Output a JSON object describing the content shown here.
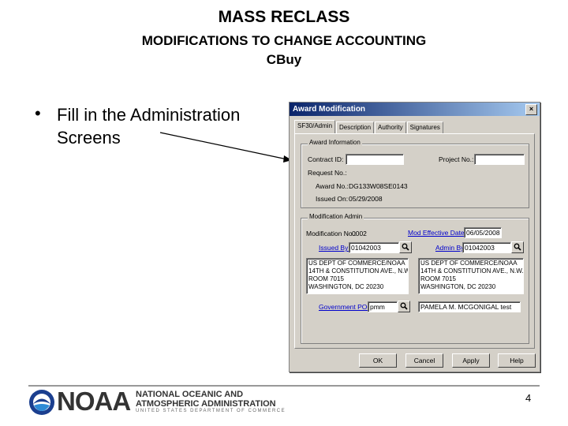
{
  "slide": {
    "title": "MASS RECLASS",
    "subtitle_line1": "MODIFICATIONS TO CHANGE ACCOUNTING",
    "subtitle_line2": "CBuy",
    "bullet_glyph": "•",
    "bullet_text": "Fill in the Administration Screens",
    "page_number": "4"
  },
  "dialog": {
    "title": "Award Modification",
    "close_glyph": "×",
    "tabs": [
      {
        "label": "SF30/Admin"
      },
      {
        "label": "Description"
      },
      {
        "label": "Authority"
      },
      {
        "label": "Signatures"
      }
    ],
    "award_info": {
      "legend": "Award Information",
      "contract_label": "Contract ID:",
      "contract_value": "",
      "project_label": "Project No.:",
      "project_value": "",
      "request_label": "Request No.:",
      "award_no_label": "Award No.:",
      "award_no_value": "DG133W08SE0143",
      "issued_on_label": "Issued On:",
      "issued_on_value": "05/29/2008"
    },
    "mod_admin": {
      "legend": "Modification Admin",
      "mod_no_label": "Modification No.:",
      "mod_no_value": "0002",
      "mod_eff_label": "Mod Effective Date:",
      "mod_eff_value": "06/05/2008",
      "issued_by_label": "Issued By:",
      "issued_by_value": "01042003",
      "admin_by_label": "Admin By:",
      "admin_by_value": "01042003",
      "issued_by_address": "US DEPT OF COMMERCE/NOAA\n14TH & CONSTITUTION AVE., N.W.\nROOM 7015\nWASHINGTON, DC 20230",
      "admin_by_address": "US DEPT OF COMMERCE/NOAA\n14TH & CONSTITUTION AVE., N.W.\nROOM 7015\nWASHINGTON, DC 20230",
      "gov_poc_label": "Government POC:",
      "gov_poc_value": "pmm",
      "gov_poc_name": "PAMELA M. MCGONIGAL test"
    },
    "buttons": {
      "ok": "OK",
      "cancel": "Cancel",
      "apply": "Apply",
      "help": "Help"
    }
  },
  "footer": {
    "logo_word": "NOAA",
    "org_line1": "NATIONAL OCEANIC AND",
    "org_line2": "ATMOSPHERIC ADMINISTRATION",
    "dept_line": "UNITED STATES DEPARTMENT OF COMMERCE"
  },
  "colors": {
    "titlebar_start": "#0a246a",
    "titlebar_end": "#a6caf0",
    "dialog_face": "#d4d0c8",
    "link_blue": "#0000cc"
  }
}
